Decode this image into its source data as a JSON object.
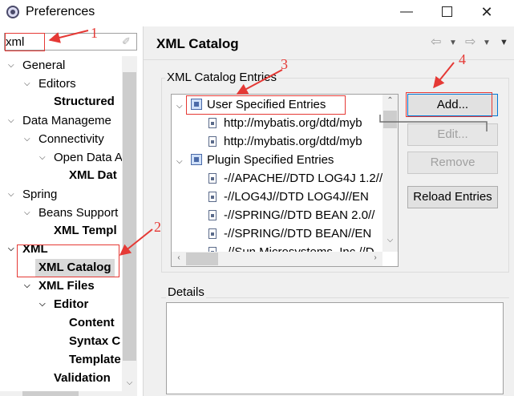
{
  "window": {
    "title": "Preferences",
    "minimize_glyph": "—",
    "close_glyph": "✕"
  },
  "filter": {
    "value": "xml",
    "clear_glyph": "✐"
  },
  "tree": {
    "items": [
      {
        "label": "General",
        "expanded": true
      },
      {
        "label": "Editors",
        "expanded": true
      },
      {
        "label": "Structured",
        "bold": true
      },
      {
        "label": "Data Manageme",
        "expanded": true
      },
      {
        "label": "Connectivity",
        "expanded": true
      },
      {
        "label": "Open Data A",
        "expanded": true
      },
      {
        "label": "XML Dat",
        "bold": true
      },
      {
        "label": "Spring",
        "expanded": true
      },
      {
        "label": "Beans Support",
        "expanded": true
      },
      {
        "label": "XML Templ",
        "bold": true
      },
      {
        "label": "XML",
        "expanded": true,
        "bold": true
      },
      {
        "label": "XML Catalog",
        "bold": true,
        "selected": true
      },
      {
        "label": "XML Files",
        "expanded": true,
        "bold": true
      },
      {
        "label": "Editor",
        "expanded": true,
        "bold": true
      },
      {
        "label": "Content",
        "bold": true
      },
      {
        "label": "Syntax C",
        "bold": true
      },
      {
        "label": "Template",
        "bold": true
      },
      {
        "label": "Validation",
        "bold": true
      }
    ]
  },
  "page": {
    "title": "XML Catalog"
  },
  "entries": {
    "group_label": "XML Catalog Entries",
    "rows": [
      {
        "label": "User Specified Entries"
      },
      {
        "label": "http://mybatis.org/dtd/myb"
      },
      {
        "label": "http://mybatis.org/dtd/myb"
      },
      {
        "label": "Plugin Specified Entries"
      },
      {
        "label": "-//APACHE//DTD LOG4J 1.2//"
      },
      {
        "label": "-//LOG4J//DTD LOG4J//EN"
      },
      {
        "label": "-//SPRING//DTD BEAN 2.0//"
      },
      {
        "label": "-//SPRING//DTD BEAN//EN"
      },
      {
        "label": "-//Sun Microsystems, Inc.//D"
      }
    ]
  },
  "buttons": {
    "add": "Add...",
    "edit": "Edit...",
    "remove": "Remove",
    "reload": "Reload Entries"
  },
  "details": {
    "label": "Details"
  },
  "annotations": {
    "n1": "1",
    "n2": "2",
    "n3": "3",
    "n4": "4",
    "color": "#e53935"
  }
}
